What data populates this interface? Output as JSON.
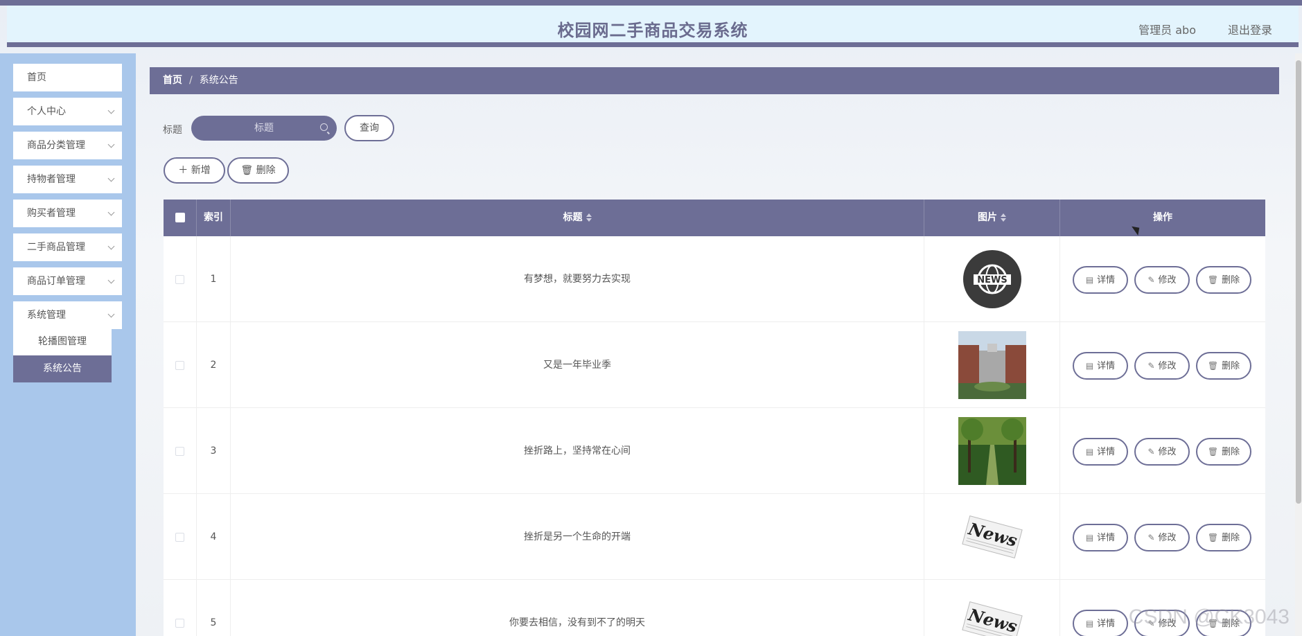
{
  "header": {
    "title": "校园网二手商品交易系统",
    "user": "管理员 abo",
    "logout": "退出登录"
  },
  "sidebar": {
    "items": [
      {
        "label": "首页"
      },
      {
        "label": "个人中心"
      },
      {
        "label": "商品分类管理"
      },
      {
        "label": "持物者管理"
      },
      {
        "label": "购买者管理"
      },
      {
        "label": "二手商品管理"
      },
      {
        "label": "商品订单管理"
      },
      {
        "label": "系统管理"
      }
    ],
    "sub_items": [
      {
        "label": "轮播图管理"
      },
      {
        "label": "系统公告"
      }
    ]
  },
  "breadcrumb": {
    "home": "首页",
    "separator": "/",
    "current": "系统公告"
  },
  "search": {
    "label": "标题",
    "placeholder": "标题",
    "button": "查询"
  },
  "toolbar": {
    "add": "新增",
    "delete": "删除"
  },
  "table": {
    "headers": {
      "index": "索引",
      "title": "标题",
      "image": "图片",
      "actions": "操作"
    },
    "rows": [
      {
        "index": "1",
        "title": "有梦想，就要努力去实现",
        "image": "news-globe-icon"
      },
      {
        "index": "2",
        "title": "又是一年毕业季",
        "image": "campus-building-photo"
      },
      {
        "index": "3",
        "title": "挫折路上，坚持常在心间",
        "image": "tree-path-photo"
      },
      {
        "index": "4",
        "title": "挫折是另一个生命的开端",
        "image": "newspaper-icon"
      },
      {
        "index": "5",
        "title": "你要去相信，没有到不了的明天",
        "image": "newspaper-icon"
      }
    ],
    "row_actions": {
      "detail": "详情",
      "edit": "修改",
      "delete": "删除"
    }
  },
  "watermark": "CSDN @CK3043",
  "colors": {
    "accent": "#6d6e96",
    "sidebar": "#a9c7eb",
    "header_bg": "#e3f4fd"
  }
}
